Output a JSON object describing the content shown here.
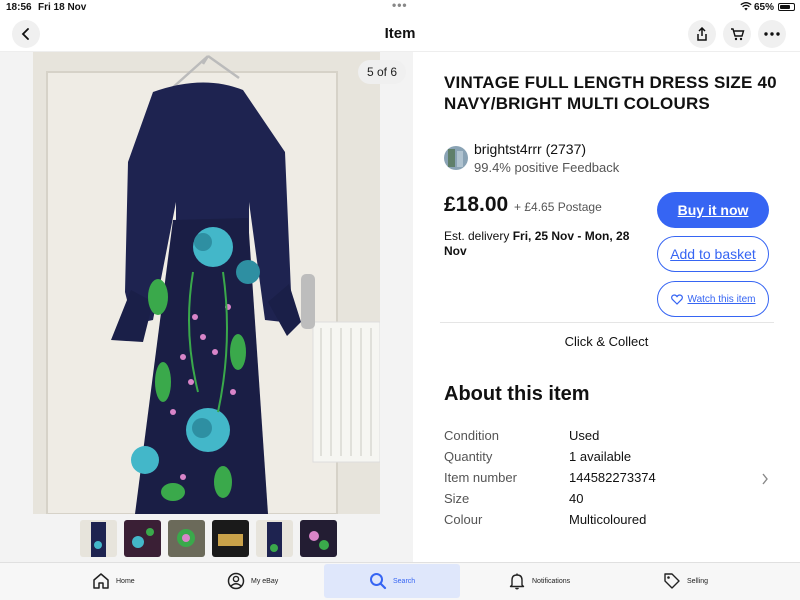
{
  "status": {
    "time": "18:56",
    "date": "Fri 18 Nov",
    "battery": "65%",
    "battery_fraction": 0.65
  },
  "nav": {
    "title": "Item"
  },
  "gallery": {
    "counter": "5 of 6"
  },
  "listing": {
    "title": "VINTAGE FULL LENGTH DRESS SIZE 40 NAVY/BRIGHT MULTI COLOURS",
    "seller_name": "brightst4rrr (2737)",
    "seller_feedback": "99.4% positive Feedback",
    "price": "£18.00",
    "postage": "+ £4.65 Postage",
    "delivery_prefix": "Est. delivery",
    "delivery_dates": "Fri, 25 Nov - Mon, 28 Nov",
    "buy_label": "Buy it now",
    "basket_label": "Add to basket",
    "watch_label": "Watch this item",
    "collect_label": "Click & Collect"
  },
  "about": {
    "heading": "About this item",
    "specs": [
      {
        "label": "Condition",
        "value": "Used"
      },
      {
        "label": "Quantity",
        "value": "1 available"
      },
      {
        "label": "Item number",
        "value": "144582273374"
      },
      {
        "label": "Size",
        "value": "40"
      },
      {
        "label": "Colour",
        "value": "Multicoloured"
      }
    ]
  },
  "tabs": [
    {
      "label": "Home",
      "icon": "home-icon"
    },
    {
      "label": "My eBay",
      "icon": "user-icon"
    },
    {
      "label": "Search",
      "icon": "search-icon"
    },
    {
      "label": "Notifications",
      "icon": "bell-icon"
    },
    {
      "label": "Selling",
      "icon": "tag-icon"
    }
  ],
  "colors": {
    "accent": "#3665f3",
    "active_tab_bg": "#dfe7fb"
  }
}
